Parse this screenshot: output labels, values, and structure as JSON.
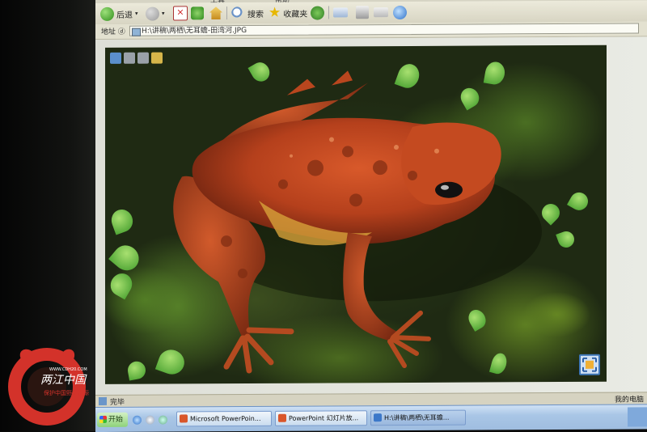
{
  "window": {
    "menu": {
      "tools": "工具",
      "help": "帮助"
    },
    "toolbar": {
      "back_label": "后退",
      "search_label": "搜索",
      "favorites_label": "收藏夹"
    },
    "address": {
      "label": "地址 ⓓ",
      "value": "H:\\讲稿\\两栖\\无耳蟾-田湾河.JPG"
    },
    "status": {
      "text": "完毕",
      "zone": "我的电脑"
    }
  },
  "taskbar": {
    "start_label": "开始",
    "tasks": [
      {
        "label": "Microsoft PowerPoin..."
      },
      {
        "label": "PowerPoint 幻灯片放..."
      },
      {
        "label": "H:\\讲稿\\两栖\\无耳蟾..."
      }
    ]
  },
  "watermark": {
    "site": "WWW.CDH20.COM",
    "name": "两江中国",
    "slogan": "保护中国野生资源"
  },
  "colors": {
    "frog_body": "#c2461f",
    "moss": "#3b5a1d",
    "taskbar": "#a9c6e6"
  },
  "icons": [
    "back-arrow-icon",
    "forward-arrow-icon",
    "stop-icon",
    "refresh-icon",
    "home-icon",
    "search-icon",
    "favorites-star-icon",
    "media-icon",
    "mail-icon",
    "print-icon",
    "ie-icon",
    "expand-icon"
  ]
}
